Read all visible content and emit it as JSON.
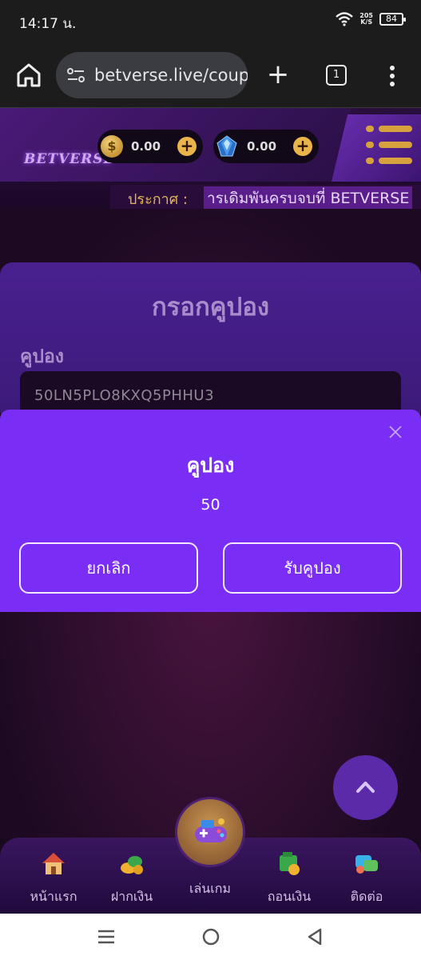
{
  "status_bar": {
    "time": "14:17 น.",
    "net_speed_value": "205",
    "net_speed_unit": "K/S",
    "battery": "84"
  },
  "browser": {
    "url": "betverse.live/coupon",
    "tab_count": "1"
  },
  "header": {
    "logo": "BETVERSE",
    "coin_balance": "0.00",
    "gem_balance": "0.00",
    "announce_label": "ประกาศ :",
    "announce_text": "ารเดิมพันครบจบที่ BETVERSE"
  },
  "coupon_form": {
    "title": "กรอกคูปอง",
    "field_label": "คูปอง",
    "field_value": "50LN5PLO8KXQ5PHHU3"
  },
  "dialog": {
    "title": "คูปอง",
    "value": "50",
    "cancel_label": "ยกเลิก",
    "claim_label": "รับคูปอง"
  },
  "bottom_nav": {
    "items": [
      {
        "label": "หน้าแรก",
        "icon": "house-icon"
      },
      {
        "label": "ฝากเงิน",
        "icon": "coins-deposit-icon"
      },
      {
        "label": "เล่นเกม",
        "icon": "gamepad-icon"
      },
      {
        "label": "ถอนเงิน",
        "icon": "money-withdraw-icon"
      },
      {
        "label": "ติดต่อ",
        "icon": "contact-icon"
      }
    ]
  },
  "colors": {
    "accent": "#7a2ef5",
    "gold": "#e9b44a",
    "card": "#4a2090"
  }
}
